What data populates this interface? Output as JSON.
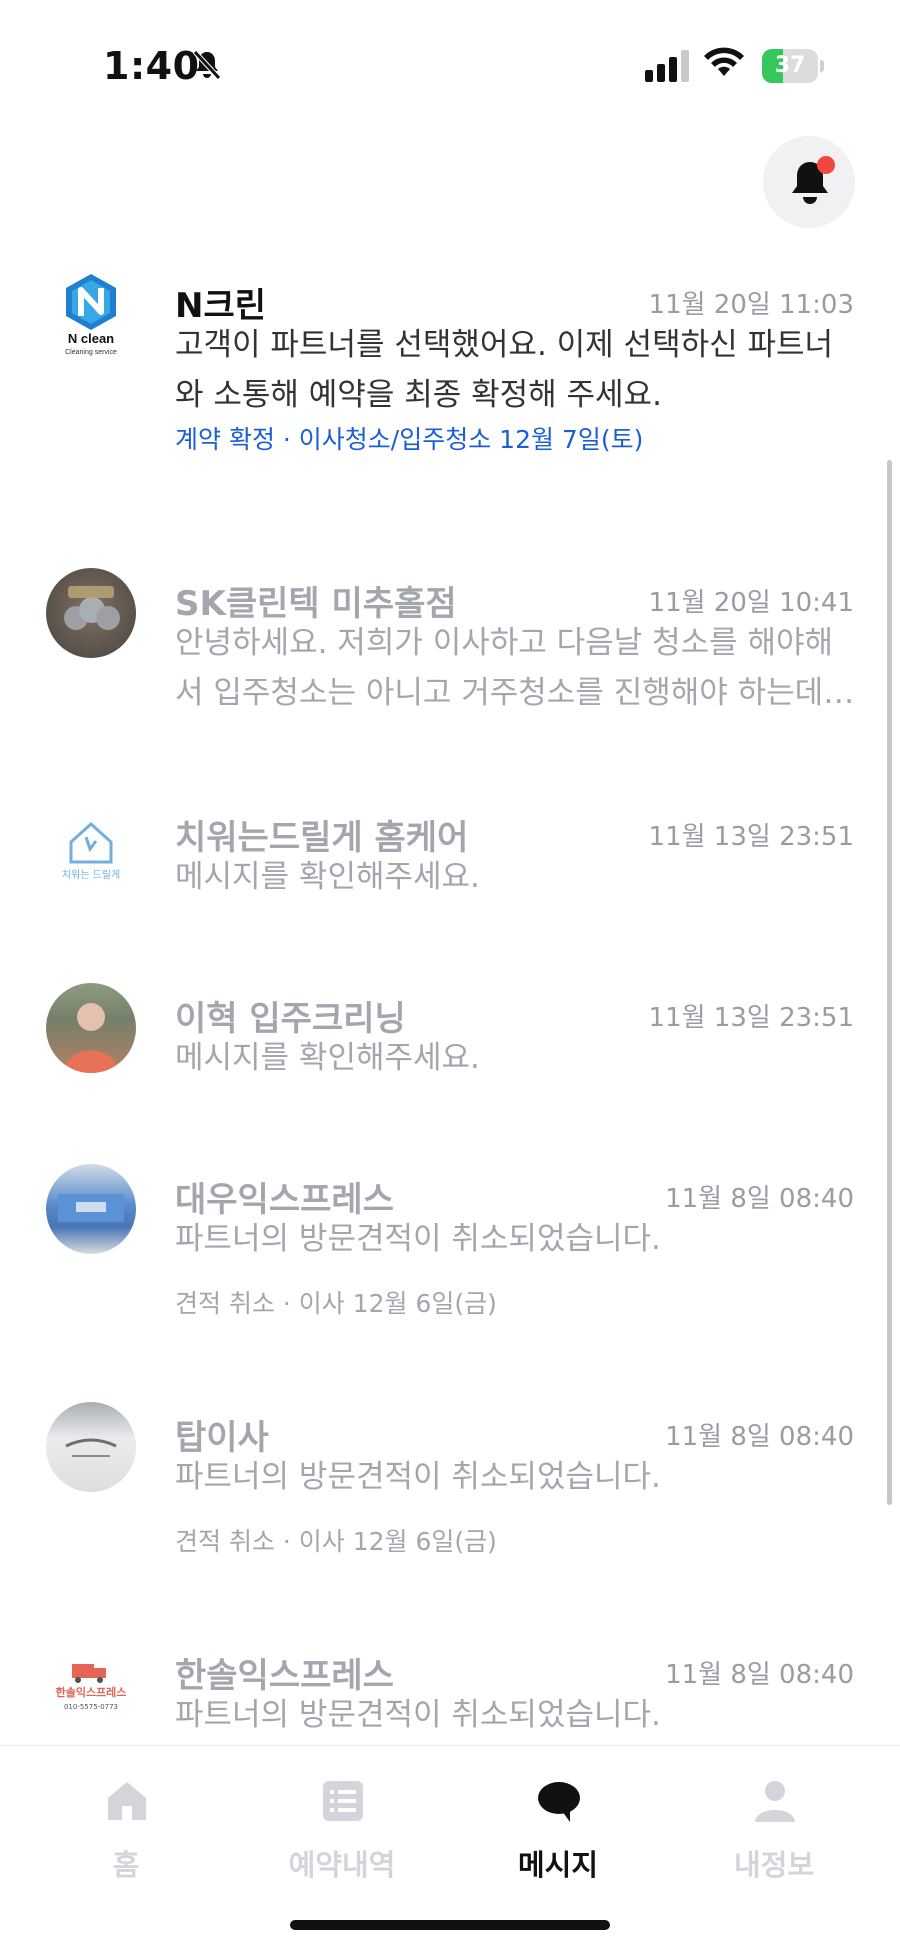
{
  "status_bar": {
    "time": "1:40",
    "battery": "37",
    "battery_level": 0.37
  },
  "messages": [
    {
      "name": "N크린",
      "time": "11월 20일 11:03",
      "preview": "고객이 파트너를 선택했어요. 이제 선택하신 파트너와 소통해 예약을 최종 확정해 주세요.",
      "sub": "계약 확정 · 이사청소/입주청소 12월 7일(토)",
      "logo_text": "N clean",
      "logo_sub": "Cleaning service",
      "accent": "#1a5fd6"
    },
    {
      "name": "SK클린텍 미추홀점",
      "time": "11월 20일 10:41",
      "preview": "안녕하세요. 저희가 이사하고 다음날 청소를 해야해서 입주청소는 아니고 거주청소를 진행해야 하는데 가능할까요?"
    },
    {
      "name": "치워는드릴게 홈케어",
      "time": "11월 13일 23:51",
      "preview": "메시지를 확인해주세요.",
      "logo_text": "치워는 드릴게"
    },
    {
      "name": "이혁 입주크리닝",
      "time": "11월 13일 23:51",
      "preview": "메시지를 확인해주세요."
    },
    {
      "name": "대우익스프레스",
      "time": "11월 8일 08:40",
      "preview": "파트너의 방문견적이 취소되었습니다.",
      "sub": "견적 취소 · 이사 12월 6일(금)"
    },
    {
      "name": "탑이사",
      "time": "11월 8일 08:40",
      "preview": "파트너의 방문견적이 취소되었습니다.",
      "sub": "견적 취소 · 이사 12월 6일(금)"
    },
    {
      "name": "한솔익스프레스",
      "time": "11월 8일 08:40",
      "preview": "파트너의 방문견적이 취소되었습니다.",
      "logo_text": "한솔익스프레스",
      "logo_phone": "010-5575-0773"
    }
  ],
  "tabs": [
    {
      "label": "홈",
      "icon": "home-icon"
    },
    {
      "label": "예약내역",
      "icon": "list-icon"
    },
    {
      "label": "메시지",
      "icon": "chat-icon"
    },
    {
      "label": "내정보",
      "icon": "person-icon"
    }
  ],
  "colors": {
    "accent": "#1a5fd6",
    "notification_dot": "#f0483e",
    "battery": "#34c759"
  }
}
